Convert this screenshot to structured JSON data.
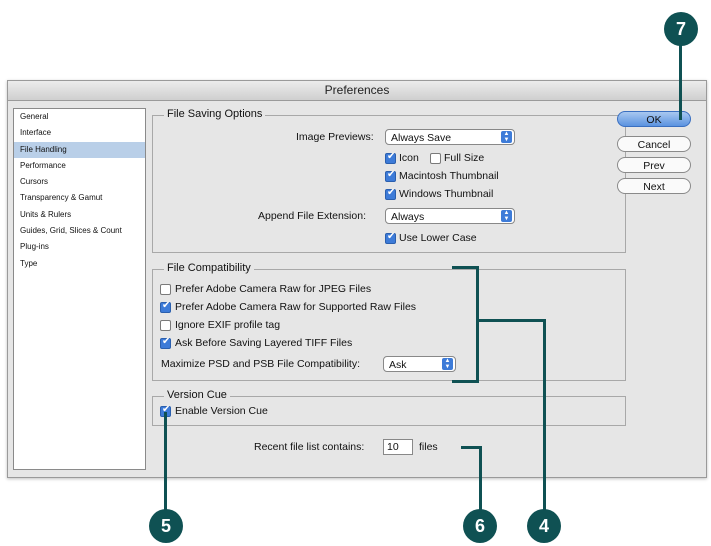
{
  "window": {
    "title": "Preferences"
  },
  "sidebar": {
    "items": [
      {
        "label": "General"
      },
      {
        "label": "Interface"
      },
      {
        "label": "File Handling",
        "selected": true
      },
      {
        "label": "Performance"
      },
      {
        "label": "Cursors"
      },
      {
        "label": "Transparency & Gamut"
      },
      {
        "label": "Units & Rulers"
      },
      {
        "label": "Guides, Grid, Slices & Count"
      },
      {
        "label": "Plug-ins"
      },
      {
        "label": "Type"
      }
    ]
  },
  "file_saving": {
    "title": "File Saving Options",
    "image_previews_label": "Image Previews:",
    "image_previews_value": "Always Save",
    "icon_label": "Icon",
    "icon_checked": true,
    "full_size_label": "Full Size",
    "full_size_checked": false,
    "mac_thumb_label": "Macintosh Thumbnail",
    "mac_thumb_checked": true,
    "win_thumb_label": "Windows Thumbnail",
    "win_thumb_checked": true,
    "append_ext_label": "Append File Extension:",
    "append_ext_value": "Always",
    "lower_case_label": "Use Lower Case",
    "lower_case_checked": true
  },
  "file_compat": {
    "title": "File Compatibility",
    "jpeg_label": "Prefer Adobe Camera Raw for JPEG Files",
    "jpeg_checked": false,
    "raw_label": "Prefer Adobe Camera Raw for Supported Raw Files",
    "raw_checked": true,
    "exif_label": "Ignore EXIF profile tag",
    "exif_checked": false,
    "tiff_label": "Ask Before Saving Layered TIFF Files",
    "tiff_checked": true,
    "maximize_label": "Maximize PSD and PSB File Compatibility:",
    "maximize_value": "Ask"
  },
  "version_cue": {
    "title": "Version Cue",
    "enable_label": "Enable Version Cue",
    "enable_checked": true
  },
  "recent": {
    "label": "Recent file list contains:",
    "value": "10",
    "suffix": "files"
  },
  "buttons": {
    "ok": "OK",
    "cancel": "Cancel",
    "prev": "Prev",
    "next": "Next"
  },
  "callouts": {
    "c7": "7",
    "c5": "5",
    "c6": "6",
    "c4": "4"
  },
  "colors": {
    "callout": "#0f5153",
    "selection": "#b9cfe8",
    "accent": "#3d7bd8"
  }
}
